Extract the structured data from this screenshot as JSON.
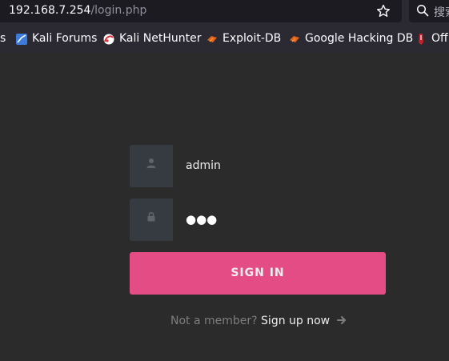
{
  "browser": {
    "url_host": "192.168.7.254",
    "url_path": "/login.php",
    "search_placeholder": "搜索",
    "bookmarks": [
      {
        "label": "s",
        "icon": "bookmark-icon"
      },
      {
        "label": "Kali Forums",
        "icon": "kali-forums-icon"
      },
      {
        "label": "Kali NetHunter",
        "icon": "kali-nethunter-icon"
      },
      {
        "label": "Exploit-DB",
        "icon": "exploit-db-icon"
      },
      {
        "label": "Google Hacking DB",
        "icon": "google-hacking-db-icon"
      },
      {
        "label": "Off",
        "icon": "offsec-icon"
      }
    ]
  },
  "login": {
    "username_value": "admin",
    "password_dots": "●●●",
    "signin_label": "SIGN IN",
    "not_member_text": "Not a member?",
    "signup_label": "Sign up now"
  },
  "colors": {
    "accent": "#e44c85",
    "page_bg": "#2b2b2b",
    "field_bg": "#363b41"
  }
}
